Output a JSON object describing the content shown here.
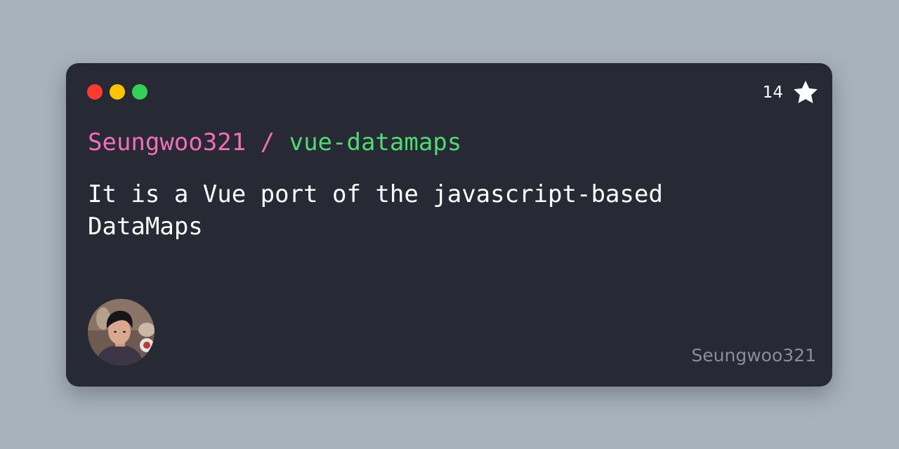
{
  "window": {
    "controls": [
      {
        "name": "close",
        "color": "#ff3b30"
      },
      {
        "name": "minimize",
        "color": "#ffc400"
      },
      {
        "name": "maximize",
        "color": "#33d058"
      }
    ]
  },
  "repo": {
    "owner": "Seungwoo321",
    "separator": " / ",
    "name": "vue-datamaps",
    "owner_color": "#f06fb6",
    "name_color": "#4fdb72",
    "stars": "14",
    "description": "It is a Vue port of the javascript-based DataMaps"
  },
  "footer": {
    "username": "Seungwoo321",
    "avatar_icon": "user-avatar-photo"
  },
  "icons": {
    "star": "star-icon"
  }
}
